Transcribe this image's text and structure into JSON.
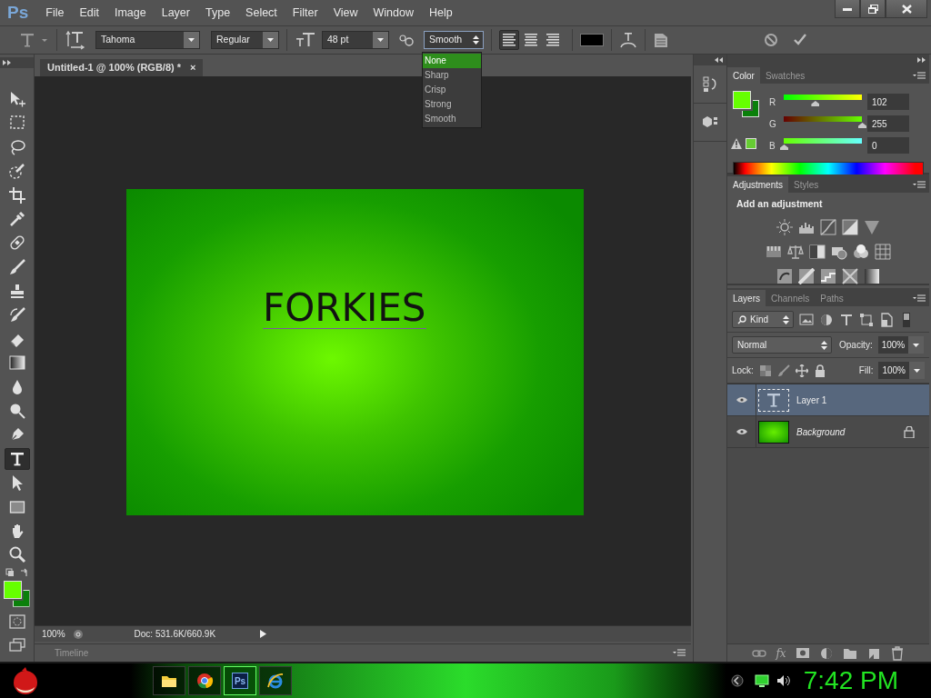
{
  "app": {
    "logo": "Ps"
  },
  "menu": [
    "File",
    "Edit",
    "Image",
    "Layer",
    "Type",
    "Select",
    "Filter",
    "View",
    "Window",
    "Help"
  ],
  "options_bar": {
    "font_family": "Tahoma",
    "font_style": "Regular",
    "font_size": "48 pt",
    "antialias": "Smooth",
    "antialias_menu": [
      {
        "label": "None",
        "selected": true
      },
      {
        "label": "Sharp",
        "selected": false
      },
      {
        "label": "Crisp",
        "selected": false
      },
      {
        "label": "Strong",
        "selected": false
      },
      {
        "label": "Smooth",
        "selected": false
      }
    ],
    "alignments": [
      {
        "selected": true
      },
      {
        "selected": false
      },
      {
        "selected": false
      }
    ]
  },
  "tools": [
    {
      "kind": "move",
      "selected": false
    },
    {
      "kind": "marquee",
      "selected": false
    },
    {
      "kind": "lasso",
      "selected": false
    },
    {
      "kind": "quickselect",
      "selected": false
    },
    {
      "kind": "crop",
      "selected": false
    },
    {
      "kind": "eyedropper",
      "selected": false
    },
    {
      "kind": "healing",
      "selected": false
    },
    {
      "kind": "brush",
      "selected": false
    },
    {
      "kind": "stamp",
      "selected": false
    },
    {
      "kind": "history",
      "selected": false
    },
    {
      "kind": "eraser",
      "selected": false
    },
    {
      "kind": "gradient",
      "selected": false
    },
    {
      "kind": "blur",
      "selected": false
    },
    {
      "kind": "dodge",
      "selected": false
    },
    {
      "kind": "pen",
      "selected": false
    },
    {
      "kind": "type",
      "selected": true
    },
    {
      "kind": "path",
      "selected": false
    },
    {
      "kind": "shape",
      "selected": false
    },
    {
      "kind": "hand",
      "selected": false
    },
    {
      "kind": "zoom",
      "selected": false
    }
  ],
  "document": {
    "tab_title": "Untitled-1 @ 100% (RGB/8) *",
    "close": "×",
    "canvas_text": "FORKIES"
  },
  "status_bar": {
    "zoom": "100%",
    "doc_info": "Doc: 531.6K/660.9K"
  },
  "timeline": {
    "label": "Timeline"
  },
  "color_panel": {
    "tabs": [
      {
        "label": "Color",
        "selected": true
      },
      {
        "label": "Swatches",
        "selected": false
      }
    ],
    "channels": [
      {
        "name": "R",
        "level": 0.4,
        "reading": "102"
      },
      {
        "name": "G",
        "level": 1,
        "reading": "255"
      },
      {
        "name": "B",
        "level": 0,
        "reading": "0"
      }
    ]
  },
  "adjustments_panel": {
    "tabs": [
      {
        "label": "Adjustments",
        "selected": true
      },
      {
        "label": "Styles",
        "selected": false
      }
    ],
    "heading": "Add an adjustment"
  },
  "layers_panel": {
    "tabs": [
      {
        "label": "Layers",
        "selected": true
      },
      {
        "label": "Channels",
        "selected": false
      },
      {
        "label": "Paths",
        "selected": false
      }
    ],
    "filter": "Kind",
    "blend_mode": "Normal",
    "opacity_label": "Opacity:",
    "opacity": "100%",
    "lock_label": "Lock:",
    "fill_label": "Fill:",
    "fill": "100%",
    "layers": [
      {
        "name": "Layer 1",
        "kind": "text",
        "selected": true,
        "visible": true,
        "locked": false
      },
      {
        "name": "Background",
        "kind": "background",
        "selected": false,
        "visible": true,
        "locked": true
      }
    ],
    "effects_button": "fx"
  },
  "taskbar": {
    "apps": [
      {
        "kind": "folder",
        "selected": false
      },
      {
        "kind": "browser",
        "selected": false
      },
      {
        "kind": "photoshop",
        "label": "Ps",
        "selected": true
      },
      {
        "kind": "explorer",
        "selected": false
      }
    ],
    "clock": "7:42 PM"
  }
}
